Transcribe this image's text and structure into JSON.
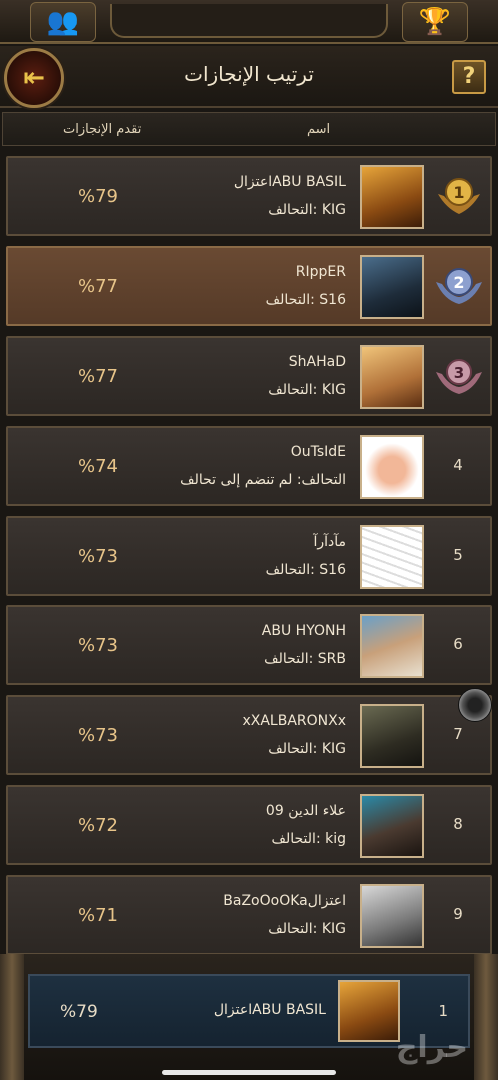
{
  "header": {
    "title": "ترتيب الإنجازات",
    "help_label": "?",
    "back_glyph": "⇤",
    "left_tab_icon": "👥",
    "right_tab_icon": "🏆"
  },
  "columns": {
    "name": "اسم",
    "progress": "تقدم الإنجازات"
  },
  "rows": [
    {
      "rank": "1",
      "name": "اعتزالABU BASIL",
      "alliance": "التحالف: KIG",
      "progress": "%79",
      "avatar": "lion-avatar",
      "medal": "gold"
    },
    {
      "rank": "2",
      "name": "RIppER",
      "alliance": "التحالف: S16",
      "progress": "%77",
      "avatar": "warrior-avatar",
      "medal": "silver"
    },
    {
      "rank": "3",
      "name": "ShAHaD",
      "alliance": "التحالف: KIG",
      "progress": "%77",
      "avatar": "girl-avatar",
      "medal": "bronze"
    },
    {
      "rank": "4",
      "name": "OuTsIdE",
      "alliance": "التحالف: لم تنضم إلى تحالف",
      "progress": "%74",
      "avatar": "baby-avatar"
    },
    {
      "rank": "5",
      "name": "مآدآرآ",
      "alliance": "التحالف: S16",
      "progress": "%73",
      "avatar": "calligraphy-avatar"
    },
    {
      "rank": "6",
      "name": "ABU HYONH",
      "alliance": "التحالف: SRB",
      "progress": "%73",
      "avatar": "man-avatar"
    },
    {
      "rank": "7",
      "name": "xXALBARONXx",
      "alliance": "التحالف: KIG",
      "progress": "%73",
      "avatar": "knight-avatar"
    },
    {
      "rank": "8",
      "name": "علاء الدين 09",
      "alliance": "التحالف: kig",
      "progress": "%72",
      "avatar": "guy-avatar"
    },
    {
      "rank": "9",
      "name": "BaZoOoOKaاعتزال",
      "alliance": "التحالف: KIG",
      "progress": "%71",
      "avatar": "anime-avatar"
    }
  ],
  "me": {
    "rank": "1",
    "name": "اعتزالABU BASIL",
    "progress": "%79",
    "avatar": "lion-avatar"
  },
  "watermark": "حراج"
}
